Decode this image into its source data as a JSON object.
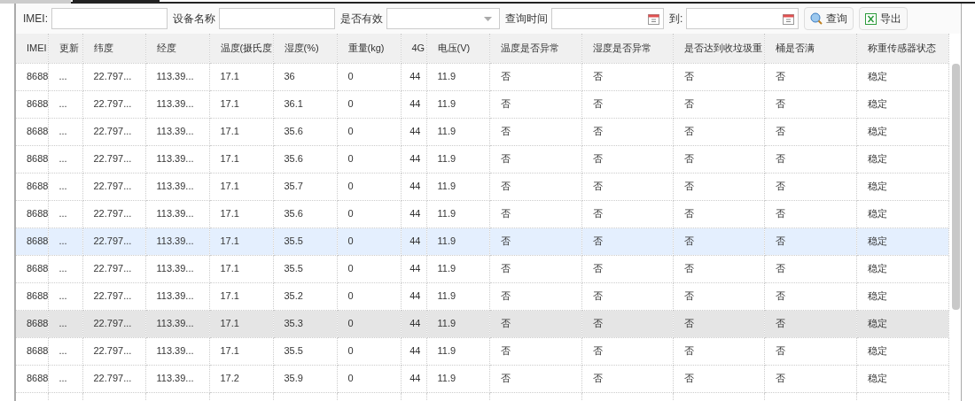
{
  "tabs": [
    {
      "selected": false
    },
    {
      "selected": true
    }
  ],
  "filters": [
    {
      "kind": "text",
      "label": "IMEI:"
    },
    {
      "kind": "text",
      "label": "设备名称"
    },
    {
      "kind": "select",
      "label": "是否有效"
    },
    {
      "kind": "date",
      "label": "查询时间"
    },
    {
      "kind": "date",
      "label": "到:"
    }
  ],
  "buttons": [
    {
      "kind": "search",
      "label": "查询"
    },
    {
      "kind": "excel",
      "label": "导出"
    }
  ],
  "table": {
    "columns": [
      "IMEI",
      "更新",
      "纬度",
      "经度",
      "温度(摄氏度",
      "湿度(%)",
      "重量(kg)",
      "4G",
      "电压(V)",
      "温度是否异常",
      "湿度是否异常",
      "是否达到收垃圾重",
      "桶是否满",
      "称重传感器状态"
    ],
    "rows": [
      {
        "selected": false,
        "hovered": false,
        "cells": [
          "8688",
          "...",
          "22.797...",
          "113.39...",
          "17.1",
          "36",
          "0",
          "44",
          "11.9",
          "否",
          "否",
          "否",
          "否",
          "稳定"
        ]
      },
      {
        "selected": false,
        "hovered": false,
        "cells": [
          "8688",
          "...",
          "22.797...",
          "113.39...",
          "17.1",
          "36.1",
          "0",
          "44",
          "11.9",
          "否",
          "否",
          "否",
          "否",
          "稳定"
        ]
      },
      {
        "selected": false,
        "hovered": false,
        "cells": [
          "8688",
          "...",
          "22.797...",
          "113.39...",
          "17.1",
          "35.6",
          "0",
          "44",
          "11.9",
          "否",
          "否",
          "否",
          "否",
          "稳定"
        ]
      },
      {
        "selected": false,
        "hovered": false,
        "cells": [
          "8688",
          "...",
          "22.797...",
          "113.39...",
          "17.1",
          "35.6",
          "0",
          "44",
          "11.9",
          "否",
          "否",
          "否",
          "否",
          "稳定"
        ]
      },
      {
        "selected": false,
        "hovered": false,
        "cells": [
          "8688",
          "...",
          "22.797...",
          "113.39...",
          "17.1",
          "35.7",
          "0",
          "44",
          "11.9",
          "否",
          "否",
          "否",
          "否",
          "稳定"
        ]
      },
      {
        "selected": false,
        "hovered": false,
        "cells": [
          "8688",
          "...",
          "22.797...",
          "113.39...",
          "17.1",
          "35.6",
          "0",
          "44",
          "11.9",
          "否",
          "否",
          "否",
          "否",
          "稳定"
        ]
      },
      {
        "selected": true,
        "hovered": false,
        "cells": [
          "8688",
          "...",
          "22.797...",
          "113.39...",
          "17.1",
          "35.5",
          "0",
          "44",
          "11.9",
          "否",
          "否",
          "否",
          "否",
          "稳定"
        ]
      },
      {
        "selected": false,
        "hovered": false,
        "cells": [
          "8688",
          "...",
          "22.797...",
          "113.39...",
          "17.1",
          "35.5",
          "0",
          "44",
          "11.9",
          "否",
          "否",
          "否",
          "否",
          "稳定"
        ]
      },
      {
        "selected": false,
        "hovered": false,
        "cells": [
          "8688",
          "...",
          "22.797...",
          "113.39...",
          "17.1",
          "35.2",
          "0",
          "44",
          "11.9",
          "否",
          "否",
          "否",
          "否",
          "稳定"
        ]
      },
      {
        "selected": false,
        "hovered": true,
        "cells": [
          "8688",
          "...",
          "22.797...",
          "113.39...",
          "17.1",
          "35.3",
          "0",
          "44",
          "11.9",
          "否",
          "否",
          "否",
          "否",
          "稳定"
        ]
      },
      {
        "selected": false,
        "hovered": false,
        "cells": [
          "8688",
          "...",
          "22.797...",
          "113.39...",
          "17.1",
          "35.5",
          "0",
          "44",
          "11.9",
          "否",
          "否",
          "否",
          "否",
          "稳定"
        ]
      },
      {
        "selected": false,
        "hovered": false,
        "cells": [
          "8688",
          "...",
          "22.797...",
          "113.39...",
          "17.2",
          "35.9",
          "0",
          "44",
          "11.9",
          "否",
          "否",
          "否",
          "否",
          "稳定"
        ]
      }
    ]
  }
}
